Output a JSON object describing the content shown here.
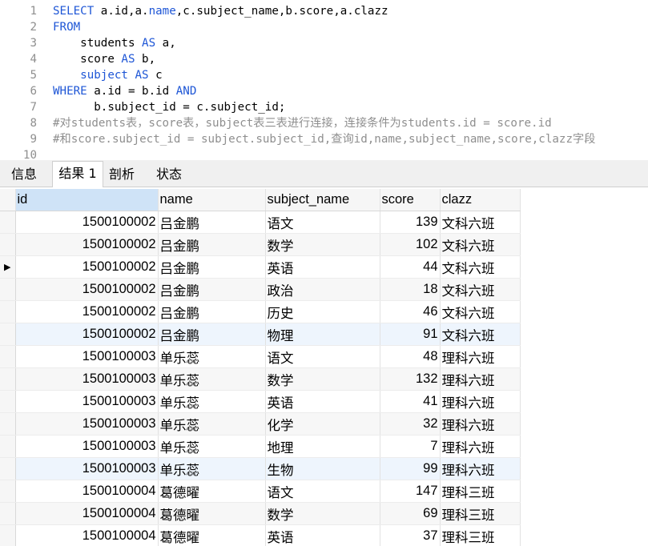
{
  "editor": {
    "lines": [
      {
        "num": "1",
        "segs": [
          [
            "kw",
            "SELECT"
          ],
          [
            "p",
            " a.id,a."
          ],
          [
            "kw",
            "name"
          ],
          [
            "p",
            ",c.subject_name,b.score,a.clazz"
          ]
        ]
      },
      {
        "num": "2",
        "segs": [
          [
            "kw",
            "FROM"
          ]
        ]
      },
      {
        "num": "3",
        "segs": [
          [
            "p",
            "    students "
          ],
          [
            "kw",
            "AS"
          ],
          [
            "p",
            " a,"
          ]
        ]
      },
      {
        "num": "4",
        "segs": [
          [
            "p",
            "    score "
          ],
          [
            "kw",
            "AS"
          ],
          [
            "p",
            " b,"
          ]
        ]
      },
      {
        "num": "5",
        "segs": [
          [
            "p",
            "    "
          ],
          [
            "kw",
            "subject"
          ],
          [
            "p",
            " "
          ],
          [
            "kw",
            "AS"
          ],
          [
            "p",
            " c"
          ]
        ]
      },
      {
        "num": "6",
        "segs": [
          [
            "kw",
            "WHERE"
          ],
          [
            "p",
            " a.id = b.id "
          ],
          [
            "kw",
            "AND"
          ]
        ]
      },
      {
        "num": "7",
        "segs": [
          [
            "p",
            "      b.subject_id = c.subject_id;"
          ]
        ]
      },
      {
        "num": "8",
        "segs": [
          [
            "cm",
            "#对students表，score表，subject表三表进行连接，连接条件为students.id = score.id"
          ]
        ]
      },
      {
        "num": "9",
        "segs": [
          [
            "cm",
            "#和score.subject_id = subject.subject_id,查询id,name,subject_name,score,clazz字段"
          ]
        ]
      },
      {
        "num": "10",
        "segs": []
      }
    ]
  },
  "tabs": [
    {
      "label": "信息",
      "active": false
    },
    {
      "label": "结果 1",
      "active": true
    },
    {
      "label": "剖析",
      "active": false
    },
    {
      "label": "状态",
      "active": false
    }
  ],
  "grid": {
    "columns": [
      "id",
      "name",
      "subject_name",
      "score",
      "clazz"
    ],
    "current_row_marker": "▶",
    "rows": [
      [
        "1500100002",
        "吕金鹏",
        "语文",
        "139",
        "文科六班"
      ],
      [
        "1500100002",
        "吕金鹏",
        "数学",
        "102",
        "文科六班"
      ],
      [
        "1500100002",
        "吕金鹏",
        "英语",
        "44",
        "文科六班"
      ],
      [
        "1500100002",
        "吕金鹏",
        "政治",
        "18",
        "文科六班"
      ],
      [
        "1500100002",
        "吕金鹏",
        "历史",
        "46",
        "文科六班"
      ],
      [
        "1500100002",
        "吕金鹏",
        "物理",
        "91",
        "文科六班"
      ],
      [
        "1500100003",
        "单乐蕊",
        "语文",
        "48",
        "理科六班"
      ],
      [
        "1500100003",
        "单乐蕊",
        "数学",
        "132",
        "理科六班"
      ],
      [
        "1500100003",
        "单乐蕊",
        "英语",
        "41",
        "理科六班"
      ],
      [
        "1500100003",
        "单乐蕊",
        "化学",
        "32",
        "理科六班"
      ],
      [
        "1500100003",
        "单乐蕊",
        "地理",
        "7",
        "理科六班"
      ],
      [
        "1500100003",
        "单乐蕊",
        "生物",
        "99",
        "理科六班"
      ],
      [
        "1500100004",
        "葛德曜",
        "语文",
        "147",
        "理科三班"
      ],
      [
        "1500100004",
        "葛德曜",
        "数学",
        "69",
        "理科三班"
      ],
      [
        "1500100004",
        "葛德曜",
        "英语",
        "37",
        "理科三班"
      ]
    ]
  }
}
